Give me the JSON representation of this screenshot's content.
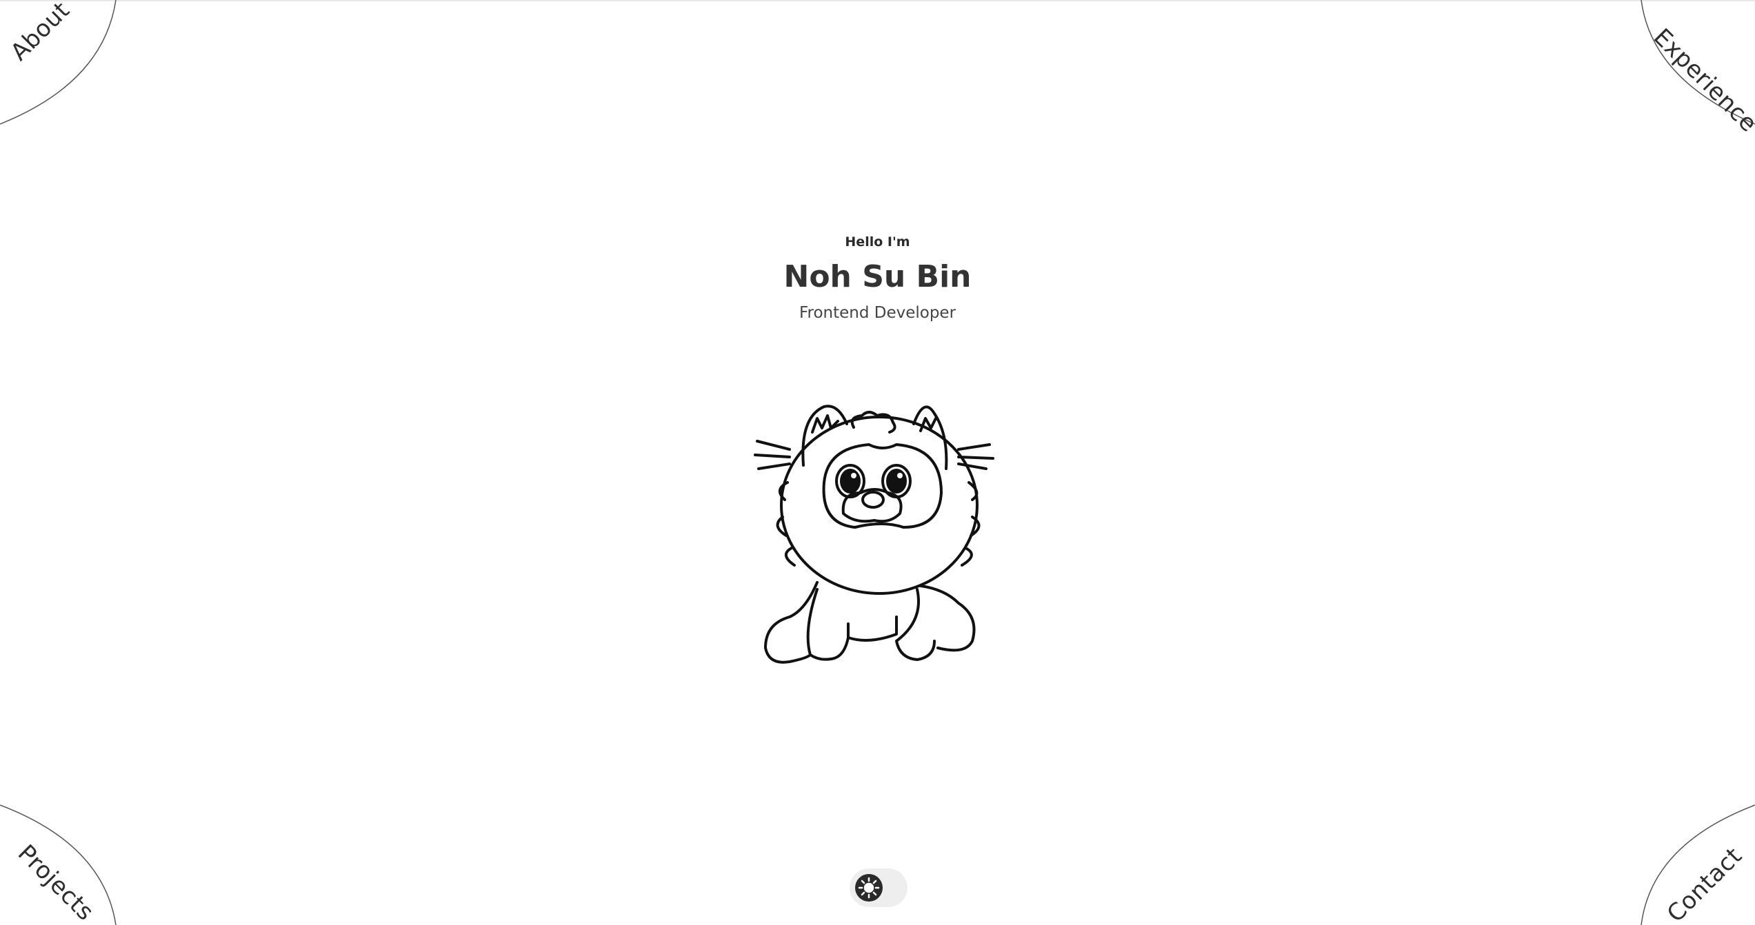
{
  "nav": {
    "about": "About",
    "experience": "Experience",
    "projects": "Projects",
    "contact": "Contact"
  },
  "hero": {
    "greeting": "Hello I'm",
    "name": "Noh Su Bin",
    "role": "Frontend Developer"
  },
  "mascot": {
    "icon": "tiger-cub-illustration-icon"
  },
  "theme_toggle": {
    "mode": "light",
    "icon": "sun-icon"
  },
  "colors": {
    "text": "#2b2b2b",
    "background": "#ffffff",
    "toggle_track": "#eeeeee",
    "toggle_knob": "#2a2a2a"
  }
}
